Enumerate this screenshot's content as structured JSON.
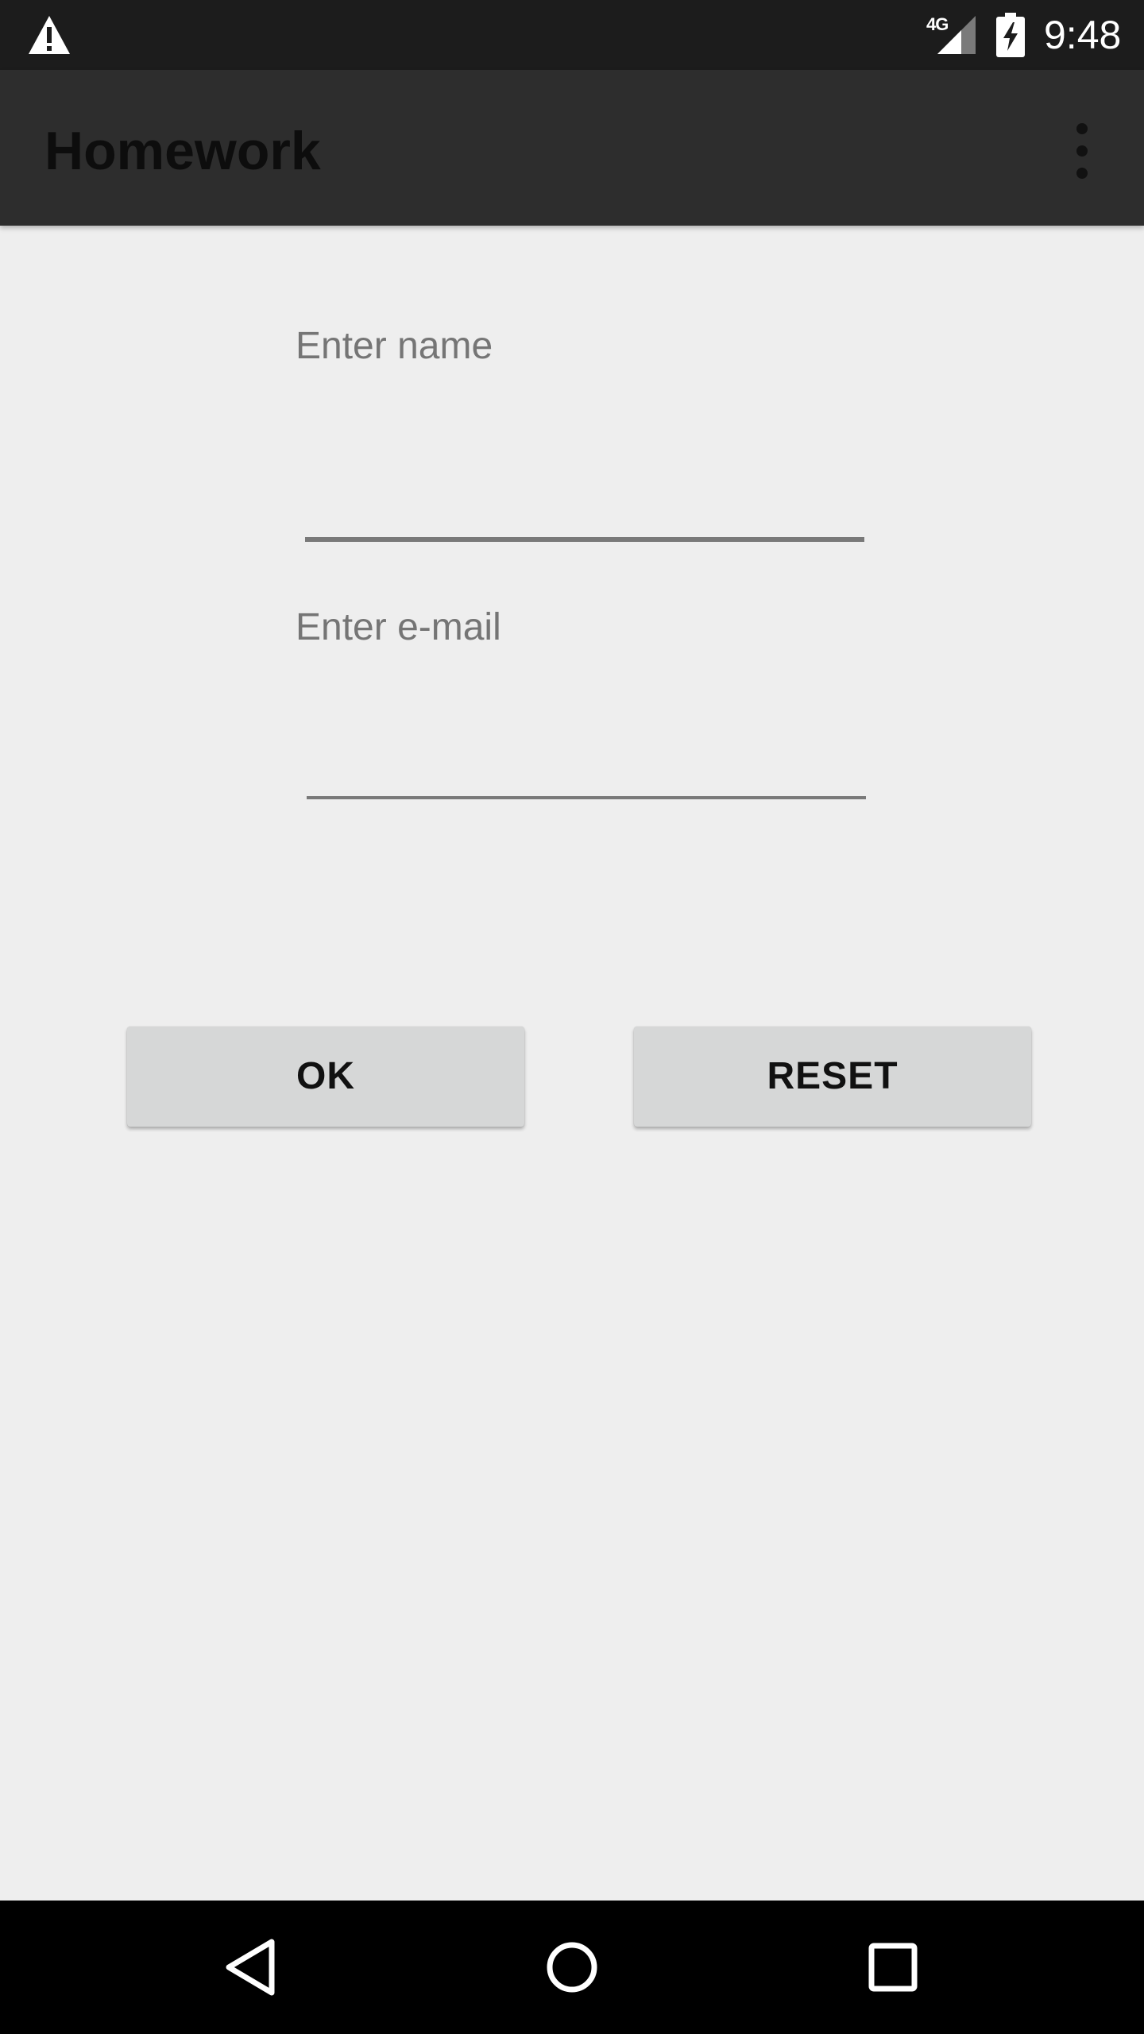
{
  "status_bar": {
    "network_type": "4G",
    "time": "9:48",
    "icons": [
      "warning-icon",
      "signal-icon",
      "battery-charging-icon"
    ]
  },
  "app_bar": {
    "title": "Homework",
    "menu_icon": "more-vert-icon"
  },
  "form": {
    "name_label": "Enter name",
    "name_value": "",
    "email_label": "Enter e-mail",
    "email_value": ""
  },
  "buttons": {
    "ok_label": "OK",
    "reset_label": "RESET"
  },
  "nav_bar": {
    "icons": [
      "back-icon",
      "home-icon",
      "recents-icon"
    ]
  },
  "colors": {
    "status_bar": "#1c1c1c",
    "app_bar": "#2d2d2d",
    "background": "#eeeeee",
    "label_text": "#757575",
    "button_bg": "#d6d7d7",
    "nav_bar": "#000000"
  }
}
